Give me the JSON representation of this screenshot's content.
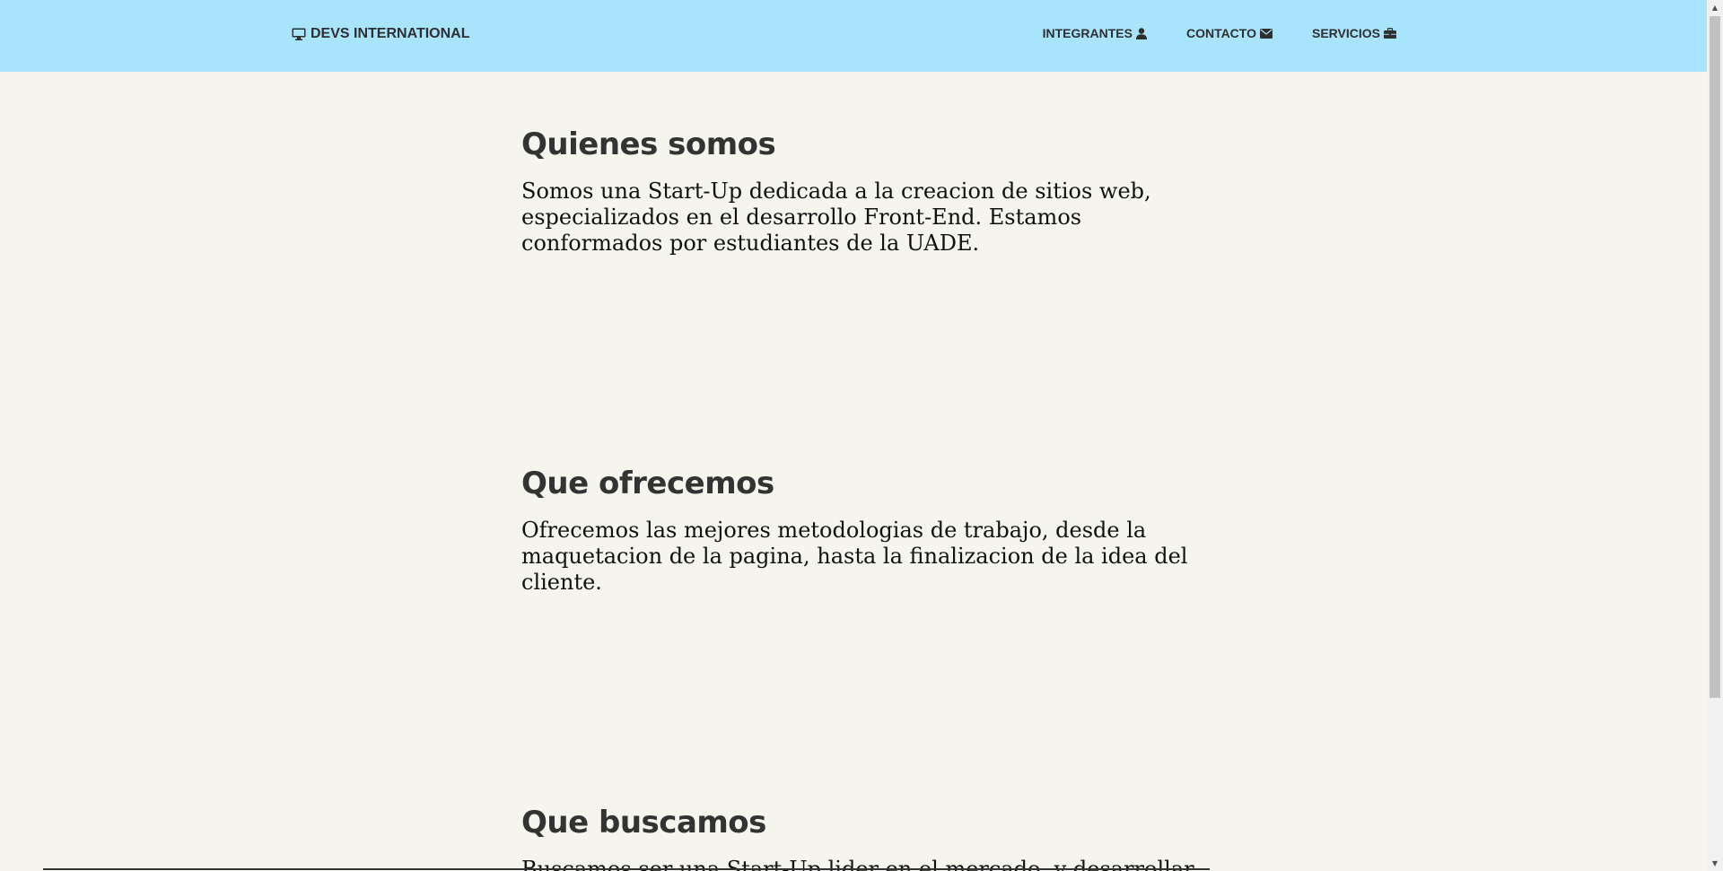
{
  "navbar": {
    "brand": {
      "label": "DEVS INTERNATIONAL",
      "icon": "desktop-icon"
    },
    "links": [
      {
        "label": "INTEGRANTES",
        "icon": "user-icon"
      },
      {
        "label": "CONTACTO",
        "icon": "envelope-icon"
      },
      {
        "label": "SERVICIOS",
        "icon": "briefcase-icon"
      }
    ],
    "background": "#a9e4fd"
  },
  "sections": [
    {
      "title": "Quienes somos",
      "text": "Somos una Start-Up dedicada a la creacion de sitios web, especializados en el desarrollo Front-End. Estamos conformados por estudiantes de la UADE."
    },
    {
      "title": "Que ofrecemos",
      "text": "Ofrecemos las mejores metodologias de trabajo, desde la maquetacion de la pagina, hasta la finalizacion de la idea del cliente."
    },
    {
      "title": "Que buscamos",
      "text": "Buscamos ser una Start-Up lider en el mercado, y desarrollar sitios web de calidad."
    }
  ],
  "colors": {
    "page_background": "#f5f5ee",
    "heading": "#333333",
    "text": "#111111"
  }
}
